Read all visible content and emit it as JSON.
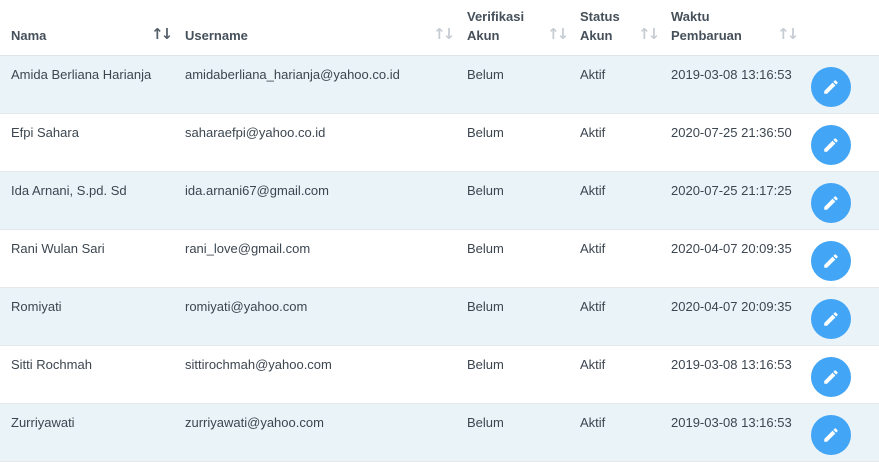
{
  "table": {
    "columns": [
      {
        "key": "nama",
        "label": "Nama",
        "sort_icon": "sort-asc-icon"
      },
      {
        "key": "username",
        "label": "Username",
        "sort_icon": "sort-icon"
      },
      {
        "key": "verifikasi",
        "label": "Verifikasi Akun",
        "sort_icon": "sort-icon"
      },
      {
        "key": "status",
        "label": "Status Akun",
        "sort_icon": "sort-icon"
      },
      {
        "key": "waktu",
        "label": "Waktu Pembaruan",
        "sort_icon": "sort-icon"
      }
    ],
    "sort_glyph": "↑↓",
    "rows": [
      {
        "nama": "Amida Berliana Harianja",
        "username": "amidaberliana_harianja@yahoo.co.id",
        "verifikasi": "Belum",
        "status": "Aktif",
        "waktu": "2019-03-08 13:16:53",
        "action_icon": "pencil-icon"
      },
      {
        "nama": "Efpi Sahara",
        "username": "saharaefpi@yahoo.co.id",
        "verifikasi": "Belum",
        "status": "Aktif",
        "waktu": "2020-07-25 21:36:50",
        "action_icon": "pencil-icon"
      },
      {
        "nama": "Ida Arnani, S.pd. Sd",
        "username": "ida.arnani67@gmail.com",
        "verifikasi": "Belum",
        "status": "Aktif",
        "waktu": "2020-07-25 21:17:25",
        "action_icon": "pencil-icon"
      },
      {
        "nama": "Rani Wulan Sari",
        "username": "rani_love@gmail.com",
        "verifikasi": "Belum",
        "status": "Aktif",
        "waktu": "2020-04-07 20:09:35",
        "action_icon": "pencil-icon"
      },
      {
        "nama": "Romiyati",
        "username": "romiyati@yahoo.com",
        "verifikasi": "Belum",
        "status": "Aktif",
        "waktu": "2020-04-07 20:09:35",
        "action_icon": "pencil-icon"
      },
      {
        "nama": "Sitti Rochmah",
        "username": "sittirochmah@yahoo.com",
        "verifikasi": "Belum",
        "status": "Aktif",
        "waktu": "2019-03-08 13:16:53",
        "action_icon": "pencil-icon"
      },
      {
        "nama": "Zurriyawati",
        "username": "zurriyawati@yahoo.com",
        "verifikasi": "Belum",
        "status": "Aktif",
        "waktu": "2019-03-08 13:16:53",
        "action_icon": "pencil-icon"
      }
    ]
  },
  "colors": {
    "accent": "#42a5f5",
    "row_alt": "#eaf3f8",
    "header_text": "#45505a",
    "sort_inactive": "#c6cdd3",
    "sort_active": "#55606a"
  }
}
